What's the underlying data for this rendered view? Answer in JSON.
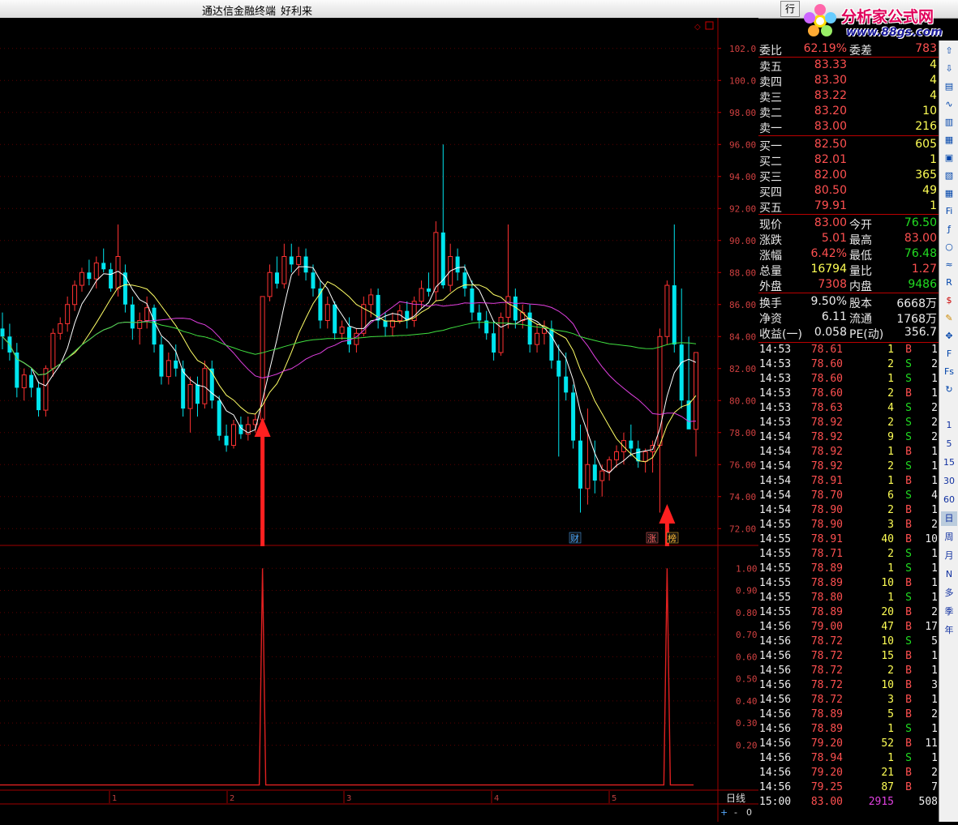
{
  "window": {
    "title": "通达信金融终端",
    "subtitle": "好利来",
    "menu_button": "行"
  },
  "logo": {
    "line1": "分析家公式网",
    "line2": "www.88gs.com",
    "faint_text": "好利来"
  },
  "colors": {
    "up": "#ff3232",
    "down": "#00e5ee",
    "ma5": "#ffffff",
    "ma10": "#ffff66",
    "ma20": "#e040e0",
    "ma60": "#40e040",
    "signal": "#e02020",
    "arrow": "#ff2020"
  },
  "price_axis": {
    "ticks": [
      "102.0",
      "100.0",
      "98.00",
      "96.00",
      "94.00",
      "92.00",
      "90.00",
      "88.00",
      "86.00",
      "84.00",
      "82.00",
      "80.00",
      "78.00",
      "76.00",
      "74.00",
      "72.00"
    ]
  },
  "indicator_axis": {
    "ticks": [
      "1.00",
      "0.90",
      "0.80",
      "0.70",
      "0.60",
      "0.50",
      "0.40",
      "0.30",
      "0.20"
    ]
  },
  "date_axis": {
    "ticks": [
      "1",
      "2",
      "3",
      "4",
      "5"
    ],
    "period_label": "日线",
    "plus": "+",
    "minus": "-",
    "zero": "0"
  },
  "events": {
    "cai": "财",
    "zhang": "涨",
    "bang": "榜"
  },
  "chart_data": {
    "type": "candlestick",
    "ylim": [
      71,
      103
    ],
    "candles": [
      [
        84.5,
        85.5,
        83.2,
        84.0
      ],
      [
        84.0,
        84.8,
        82.5,
        83.0
      ],
      [
        83.0,
        83.6,
        80.2,
        80.8
      ],
      [
        80.8,
        82.0,
        80.0,
        81.6
      ],
      [
        81.6,
        82.0,
        80.2,
        80.8
      ],
      [
        80.8,
        81.2,
        79.0,
        79.4
      ],
      [
        79.4,
        82.2,
        79.0,
        82.0
      ],
      [
        82.0,
        84.5,
        81.5,
        84.2
      ],
      [
        84.2,
        85.2,
        83.8,
        84.8
      ],
      [
        84.8,
        86.5,
        84.3,
        86.0
      ],
      [
        86.0,
        87.5,
        85.6,
        87.2
      ],
      [
        87.2,
        88.3,
        86.8,
        88.0
      ],
      [
        88.0,
        88.8,
        87.2,
        87.6
      ],
      [
        87.6,
        89.0,
        87.0,
        88.6
      ],
      [
        88.6,
        89.5,
        88.0,
        88.2
      ],
      [
        88.2,
        88.6,
        86.8,
        87.0
      ],
      [
        87.0,
        91.0,
        86.5,
        89.0
      ],
      [
        88.0,
        88.5,
        85.5,
        86.0
      ],
      [
        86.0,
        86.5,
        83.8,
        84.5
      ],
      [
        84.5,
        85.5,
        83.5,
        85.0
      ],
      [
        85.0,
        86.5,
        84.5,
        85.8
      ],
      [
        85.8,
        86.0,
        83.0,
        83.5
      ],
      [
        83.5,
        84.0,
        81.0,
        81.5
      ],
      [
        81.5,
        83.0,
        81.0,
        82.5
      ],
      [
        82.5,
        83.5,
        81.5,
        82.0
      ],
      [
        82.0,
        82.5,
        79.0,
        79.5
      ],
      [
        79.5,
        81.5,
        78.0,
        81.0
      ],
      [
        81.0,
        81.5,
        79.0,
        79.8
      ],
      [
        79.8,
        82.5,
        79.5,
        82.0
      ],
      [
        82.0,
        82.5,
        79.5,
        80.0
      ],
      [
        80.0,
        80.3,
        77.5,
        77.8
      ],
      [
        77.8,
        78.5,
        76.8,
        77.2
      ],
      [
        77.2,
        78.8,
        77.0,
        78.5
      ],
      [
        78.5,
        79.0,
        77.6,
        77.9
      ],
      [
        77.9,
        79.0,
        77.5,
        78.5
      ],
      [
        78.5,
        79.2,
        78.0,
        78.8
      ],
      [
        78.8,
        86.5,
        71.5,
        86.5
      ],
      [
        86.5,
        88.5,
        86.2,
        88.0
      ],
      [
        88.0,
        89.0,
        87.0,
        87.3
      ],
      [
        87.3,
        89.8,
        87.0,
        89.0
      ],
      [
        89.0,
        89.8,
        88.0,
        88.5
      ],
      [
        88.5,
        89.6,
        87.8,
        89.0
      ],
      [
        89.0,
        89.5,
        87.5,
        88.0
      ],
      [
        88.0,
        88.5,
        86.5,
        87.0
      ],
      [
        87.0,
        87.5,
        84.5,
        85.0
      ],
      [
        85.0,
        86.5,
        84.5,
        86.0
      ],
      [
        86.0,
        86.2,
        83.8,
        84.2
      ],
      [
        84.2,
        85.0,
        83.8,
        84.6
      ],
      [
        84.6,
        85.2,
        83.0,
        83.5
      ],
      [
        83.5,
        84.5,
        83.0,
        84.2
      ],
      [
        84.2,
        86.5,
        84.0,
        86.0
      ],
      [
        86.0,
        87.0,
        85.2,
        86.6
      ],
      [
        86.6,
        87.0,
        84.5,
        85.0
      ],
      [
        85.0,
        85.5,
        84.0,
        84.6
      ],
      [
        84.6,
        85.5,
        84.0,
        85.0
      ],
      [
        85.0,
        86.0,
        84.8,
        85.6
      ],
      [
        85.6,
        86.2,
        84.5,
        85.0
      ],
      [
        85.0,
        86.5,
        84.6,
        86.2
      ],
      [
        86.2,
        87.5,
        85.8,
        87.0
      ],
      [
        87.0,
        88.0,
        86.5,
        86.8
      ],
      [
        86.8,
        91.2,
        86.2,
        90.5
      ],
      [
        90.5,
        96.0,
        87.0,
        87.2
      ],
      [
        87.2,
        89.8,
        86.8,
        89.0
      ],
      [
        89.0,
        89.5,
        87.5,
        88.0
      ],
      [
        88.0,
        88.5,
        86.5,
        87.0
      ],
      [
        87.0,
        87.5,
        85.0,
        85.5
      ],
      [
        85.5,
        86.0,
        84.5,
        85.0
      ],
      [
        85.0,
        85.6,
        83.8,
        84.2
      ],
      [
        84.2,
        85.0,
        82.5,
        83.0
      ],
      [
        83.0,
        85.5,
        82.8,
        85.2
      ],
      [
        85.2,
        91.0,
        84.5,
        86.5
      ],
      [
        86.5,
        87.0,
        84.5,
        85.0
      ],
      [
        85.0,
        86.0,
        84.5,
        85.5
      ],
      [
        85.5,
        86.0,
        83.0,
        83.5
      ],
      [
        83.5,
        84.8,
        83.0,
        84.2
      ],
      [
        84.2,
        85.0,
        83.5,
        84.5
      ],
      [
        84.5,
        85.0,
        82.0,
        82.5
      ],
      [
        82.5,
        83.5,
        76.5,
        81.5
      ],
      [
        81.5,
        83.0,
        80.0,
        80.5
      ],
      [
        80.5,
        81.0,
        77.0,
        77.5
      ],
      [
        77.5,
        78.5,
        73.0,
        74.5
      ],
      [
        74.5,
        79.5,
        73.5,
        76.0
      ],
      [
        76.0,
        77.5,
        74.2,
        75.0
      ],
      [
        75.0,
        76.0,
        74.0,
        75.6
      ],
      [
        75.6,
        76.5,
        75.0,
        76.3
      ],
      [
        76.3,
        77.2,
        75.8,
        76.8
      ],
      [
        76.8,
        78.0,
        76.0,
        77.5
      ],
      [
        77.5,
        78.5,
        76.5,
        77.0
      ],
      [
        77.0,
        77.5,
        75.8,
        76.2
      ],
      [
        76.2,
        77.0,
        75.5,
        76.8
      ],
      [
        76.8,
        77.5,
        75.5,
        77.2
      ],
      [
        77.2,
        84.5,
        73.0,
        84.0
      ],
      [
        84.0,
        87.5,
        83.5,
        87.2
      ],
      [
        87.2,
        91.0,
        83.0,
        83.5
      ],
      [
        83.5,
        87.0,
        79.5,
        80.0
      ],
      [
        80.0,
        84.0,
        79.0,
        78.2
      ],
      [
        78.2,
        83.0,
        76.5,
        83.0
      ]
    ],
    "signal_days": [
      36,
      92
    ],
    "indicator_ylim": [
      0,
      1.1
    ]
  },
  "quote": {
    "weibi": {
      "label": "委比",
      "value": "62.19%",
      "label2": "委差",
      "value2": "783"
    },
    "sells": [
      {
        "label": "卖五",
        "price": "83.33",
        "vol": "4"
      },
      {
        "label": "卖四",
        "price": "83.30",
        "vol": "4"
      },
      {
        "label": "卖三",
        "price": "83.22",
        "vol": "4"
      },
      {
        "label": "卖二",
        "price": "83.20",
        "vol": "10"
      },
      {
        "label": "卖一",
        "price": "83.00",
        "vol": "216"
      }
    ],
    "buys": [
      {
        "label": "买一",
        "price": "82.50",
        "vol": "605"
      },
      {
        "label": "买二",
        "price": "82.01",
        "vol": "1"
      },
      {
        "label": "买三",
        "price": "82.00",
        "vol": "365"
      },
      {
        "label": "买四",
        "price": "80.50",
        "vol": "49"
      },
      {
        "label": "买五",
        "price": "79.91",
        "vol": "1"
      }
    ],
    "stats": [
      {
        "l1": "现价",
        "v1": "83.00",
        "c1": "red",
        "l2": "今开",
        "v2": "76.50",
        "c2": "green"
      },
      {
        "l1": "涨跌",
        "v1": "5.01",
        "c1": "red",
        "l2": "最高",
        "v2": "83.00",
        "c2": "red"
      },
      {
        "l1": "涨幅",
        "v1": "6.42%",
        "c1": "red",
        "l2": "最低",
        "v2": "76.48",
        "c2": "green"
      },
      {
        "l1": "总量",
        "v1": "16794",
        "c1": "yel",
        "l2": "量比",
        "v2": "1.27",
        "c2": "red"
      },
      {
        "l1": "外盘",
        "v1": "7308",
        "c1": "red",
        "l2": "内盘",
        "v2": "9486",
        "c2": "green"
      }
    ],
    "stats2": [
      {
        "l1": "换手",
        "v1": "9.50%",
        "l2": "股本",
        "v2": "6668万"
      },
      {
        "l1": "净资",
        "v1": "6.11",
        "l2": "流通",
        "v2": "1768万"
      },
      {
        "l1": "收益(一)",
        "v1": "0.058",
        "l2": "PE(动)",
        "v2": "356.7"
      }
    ]
  },
  "ticks": [
    {
      "t": "14:53",
      "p": "78.61",
      "v": "1",
      "s": "B",
      "n": "1"
    },
    {
      "t": "14:53",
      "p": "78.60",
      "v": "2",
      "s": "S",
      "n": "2"
    },
    {
      "t": "14:53",
      "p": "78.60",
      "v": "1",
      "s": "S",
      "n": "1"
    },
    {
      "t": "14:53",
      "p": "78.60",
      "v": "2",
      "s": "B",
      "n": "1"
    },
    {
      "t": "14:53",
      "p": "78.63",
      "v": "4",
      "s": "S",
      "n": "2"
    },
    {
      "t": "14:53",
      "p": "78.92",
      "v": "2",
      "s": "S",
      "n": "2"
    },
    {
      "t": "14:54",
      "p": "78.92",
      "v": "9",
      "s": "S",
      "n": "2"
    },
    {
      "t": "14:54",
      "p": "78.92",
      "v": "1",
      "s": "B",
      "n": "1"
    },
    {
      "t": "14:54",
      "p": "78.92",
      "v": "2",
      "s": "S",
      "n": "1"
    },
    {
      "t": "14:54",
      "p": "78.91",
      "v": "1",
      "s": "B",
      "n": "1"
    },
    {
      "t": "14:54",
      "p": "78.70",
      "v": "6",
      "s": "S",
      "n": "4"
    },
    {
      "t": "14:54",
      "p": "78.90",
      "v": "2",
      "s": "B",
      "n": "1"
    },
    {
      "t": "14:55",
      "p": "78.90",
      "v": "3",
      "s": "B",
      "n": "2"
    },
    {
      "t": "14:55",
      "p": "78.91",
      "v": "40",
      "s": "B",
      "n": "10"
    },
    {
      "t": "14:55",
      "p": "78.71",
      "v": "2",
      "s": "S",
      "n": "1"
    },
    {
      "t": "14:55",
      "p": "78.89",
      "v": "1",
      "s": "S",
      "n": "1"
    },
    {
      "t": "14:55",
      "p": "78.89",
      "v": "10",
      "s": "B",
      "n": "1"
    },
    {
      "t": "14:55",
      "p": "78.80",
      "v": "1",
      "s": "S",
      "n": "1"
    },
    {
      "t": "14:55",
      "p": "78.89",
      "v": "20",
      "s": "B",
      "n": "2"
    },
    {
      "t": "14:56",
      "p": "79.00",
      "v": "47",
      "s": "B",
      "n": "17"
    },
    {
      "t": "14:56",
      "p": "78.72",
      "v": "10",
      "s": "S",
      "n": "5"
    },
    {
      "t": "14:56",
      "p": "78.72",
      "v": "15",
      "s": "B",
      "n": "1"
    },
    {
      "t": "14:56",
      "p": "78.72",
      "v": "2",
      "s": "B",
      "n": "1"
    },
    {
      "t": "14:56",
      "p": "78.72",
      "v": "10",
      "s": "B",
      "n": "3"
    },
    {
      "t": "14:56",
      "p": "78.72",
      "v": "3",
      "s": "B",
      "n": "1"
    },
    {
      "t": "14:56",
      "p": "78.89",
      "v": "5",
      "s": "B",
      "n": "2"
    },
    {
      "t": "14:56",
      "p": "78.89",
      "v": "1",
      "s": "S",
      "n": "1"
    },
    {
      "t": "14:56",
      "p": "79.20",
      "v": "52",
      "s": "B",
      "n": "11"
    },
    {
      "t": "14:56",
      "p": "78.94",
      "v": "1",
      "s": "S",
      "n": "1"
    },
    {
      "t": "14:56",
      "p": "79.20",
      "v": "21",
      "s": "B",
      "n": "2"
    },
    {
      "t": "14:56",
      "p": "79.25",
      "v": "87",
      "s": "B",
      "n": "7"
    }
  ],
  "close_tick": {
    "t": "15:00",
    "p": "83.00",
    "v": "2915",
    "n": "508"
  },
  "sidebar": {
    "periods": [
      "1",
      "5",
      "15",
      "30",
      "60",
      "日",
      "周",
      "月",
      "N",
      "多",
      "季",
      "年"
    ],
    "icons": [
      "up-arrow-icon",
      "down-arrow-icon",
      "report-icon",
      "line-icon",
      "candle-icon",
      "bar-icon",
      "info-icon",
      "f10-icon",
      "grid-icon",
      "fiz-icon",
      "fx-icon",
      "circle-icon",
      "wave-icon",
      "rsi-icon",
      "dollar-icon",
      "pen-icon",
      "nav-icon",
      "f-icon",
      "fs-icon",
      "refresh-icon"
    ],
    "rsi": "RSI",
    "fiz": "Fiz",
    "fs": "Fs",
    "f10": "F"
  }
}
